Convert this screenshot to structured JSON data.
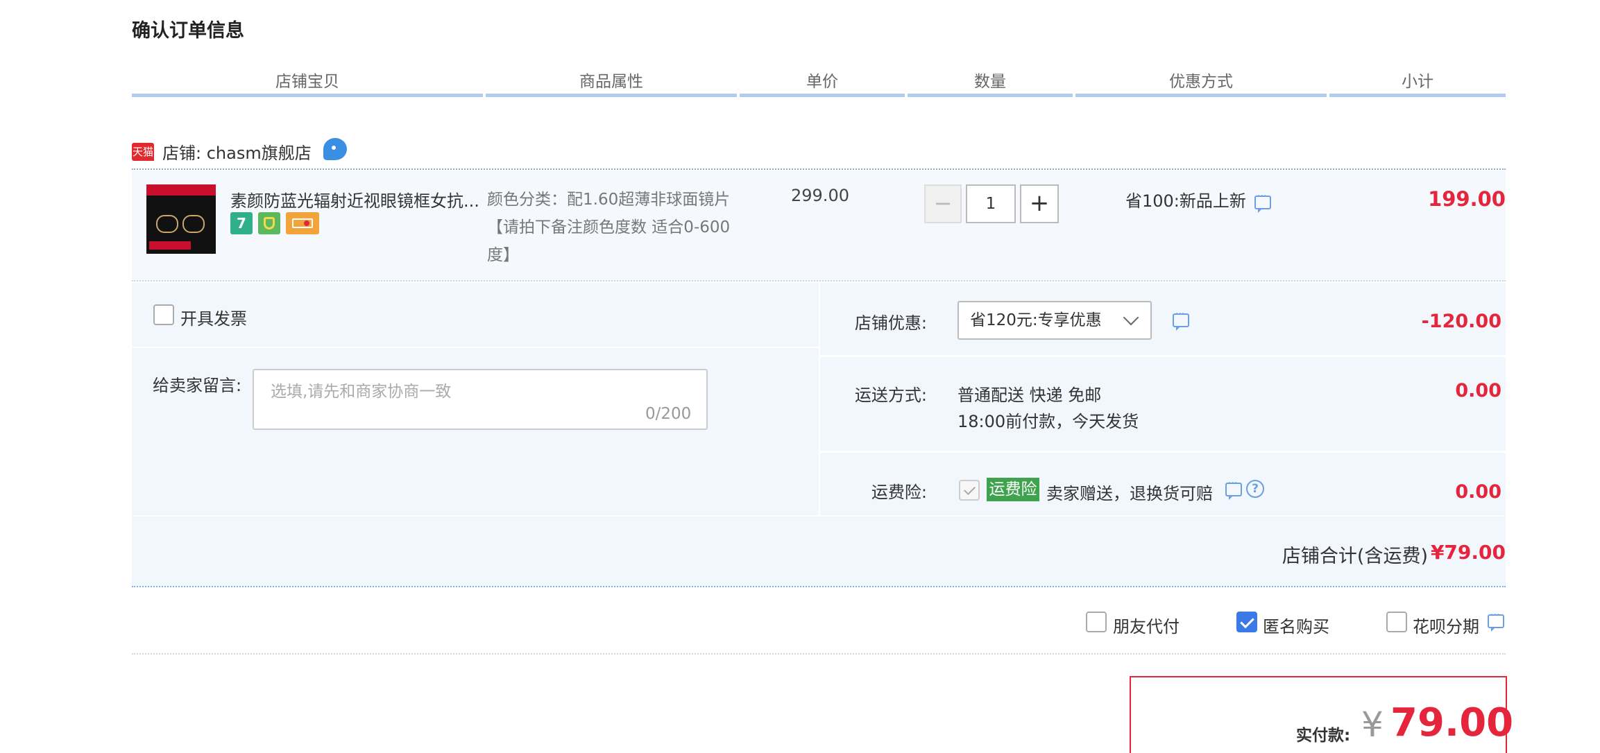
{
  "page_title": "确认订单信息",
  "columns": [
    "店铺宝贝",
    "商品属性",
    "单价",
    "数量",
    "优惠方式",
    "小计"
  ],
  "shop": {
    "badge": "天猫",
    "name": "店铺: chasm旗舰店"
  },
  "item": {
    "title": "素颜防蓝光辐射近视眼镜框女抗...",
    "service_icons": [
      {
        "name": "7",
        "color": "#2fb08a"
      },
      {
        "name": "quality-icon",
        "color": "#2fb08a"
      },
      {
        "name": "card-icon",
        "color": "#f2a33a"
      }
    ],
    "attribute": "颜色分类：配1.60超薄非球面镜片【请拍下备注颜色度数 适合0-600度】",
    "unit_price": "299.00",
    "quantity": "1",
    "qty_minus": "−",
    "qty_plus": "+",
    "promotion": "省100:新品上新",
    "subtotal": "199.00"
  },
  "invoice": {
    "label": "开具发票",
    "checked": false
  },
  "memo": {
    "label": "给卖家留言:",
    "placeholder": "选填,请先和商家协商一致",
    "counter": "0/200"
  },
  "shop_discount": {
    "label": "店铺优惠:",
    "selected": "省120元:专享优惠",
    "value": "-120.00"
  },
  "shipping": {
    "label": "运送方式:",
    "method": "普通配送 快递 免邮",
    "note": "18:00前付款，今天发货",
    "value": "0.00"
  },
  "insurance": {
    "label": "运费险:",
    "tag": "运费险",
    "desc": "卖家赠送，退换货可赔",
    "help": "?",
    "value": "0.00"
  },
  "shop_total": {
    "label": "店铺合计(含运费)",
    "value": "¥79.00"
  },
  "options": [
    {
      "label": "朋友代付",
      "checked": false
    },
    {
      "label": "匿名购买",
      "checked": true
    },
    {
      "label": "花呗分期",
      "checked": false
    }
  ],
  "payment": {
    "label": "实付款:",
    "currency": "¥",
    "amount": "79.00"
  },
  "colors": {
    "accent_red": "#e4253b",
    "header_line": "#b2cbf0",
    "panel_bg": "#f2f6fd",
    "checkbox_blue": "#3b7ae6"
  }
}
